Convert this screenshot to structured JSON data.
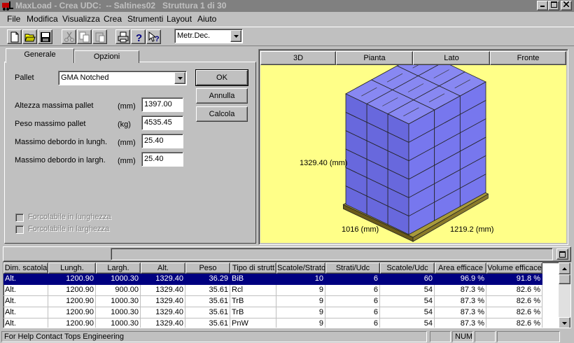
{
  "window": {
    "title": "MaxLoad - Crea UDC:  -- Saltines02   Struttura 1 di 30"
  },
  "menu": [
    "File",
    "Modifica",
    "Visualizza",
    "Crea",
    "Strumenti",
    "Layout",
    "Aiuto"
  ],
  "toolbar": {
    "buttons": [
      "new-icon",
      "open-folder-icon",
      "save-icon",
      "cut-icon",
      "copy-icon",
      "paste-icon",
      "print-icon",
      "help-icon",
      "context-help-icon"
    ],
    "units_value": "Metr.Dec."
  },
  "tabs": {
    "generale": "Generale",
    "opzioni": "Opzioni"
  },
  "form": {
    "pallet_label": "Pallet",
    "pallet_value": "GMA Notched",
    "rows": [
      {
        "label": "Altezza massima pallet",
        "unit": "(mm)",
        "value": "1397.00"
      },
      {
        "label": "Peso massimo pallet",
        "unit": "(kg)",
        "value": "4535.45"
      },
      {
        "label": "Massimo debordo in lungh.",
        "unit": "(mm)",
        "value": "25.40"
      },
      {
        "label": "Massimo debordo in largh.",
        "unit": "(mm)",
        "value": "25.40"
      }
    ],
    "ok": "OK",
    "annulla": "Annulla",
    "calcola": "Calcola",
    "check_lunghezza": "Forcolabile in lunghezza",
    "check_larghezza": "Forcolabile in larghezza"
  },
  "viewer": {
    "tabs": [
      "3D",
      "Pianta",
      "Lato",
      "Fronte"
    ],
    "height_label": "1329.40 (mm)",
    "length_label": "1016 (mm)",
    "width_label": "1219.2 (mm)",
    "colors": {
      "box": "#7777ee",
      "pallet": "#8a7a2a",
      "background": "#ffff88"
    }
  },
  "grid": {
    "headers": [
      "Dim. scatola",
      "Lungh.",
      "Largh.",
      "Alt.",
      "Peso",
      "Tipo di strutt",
      "Scatole/Strato",
      "Strati/Udc",
      "Scatole/Udc",
      "Area efficace",
      "Volume efficace"
    ],
    "rows": [
      [
        "Alt.",
        "1200.90",
        "1000.30",
        "1329.40",
        "36.29",
        "BiB",
        "10",
        "6",
        "60",
        "96.9 %",
        "91.8 %"
      ],
      [
        "Alt.",
        "1200.90",
        "900.00",
        "1329.40",
        "35.61",
        "Rcl",
        "9",
        "6",
        "54",
        "87.3 %",
        "82.6 %"
      ],
      [
        "Alt.",
        "1200.90",
        "1000.30",
        "1329.40",
        "35.61",
        "TrB",
        "9",
        "6",
        "54",
        "87.3 %",
        "82.6 %"
      ],
      [
        "Alt.",
        "1200.90",
        "1000.30",
        "1329.40",
        "35.61",
        "TrB",
        "9",
        "6",
        "54",
        "87.3 %",
        "82.6 %"
      ],
      [
        "Alt.",
        "1200.90",
        "1000.30",
        "1329.40",
        "35.61",
        "PnW",
        "9",
        "6",
        "54",
        "87.3 %",
        "82.6 %"
      ]
    ],
    "selected_row": 0
  },
  "status": {
    "text": "For Help Contact Tops Engineering",
    "num": "NUM"
  }
}
